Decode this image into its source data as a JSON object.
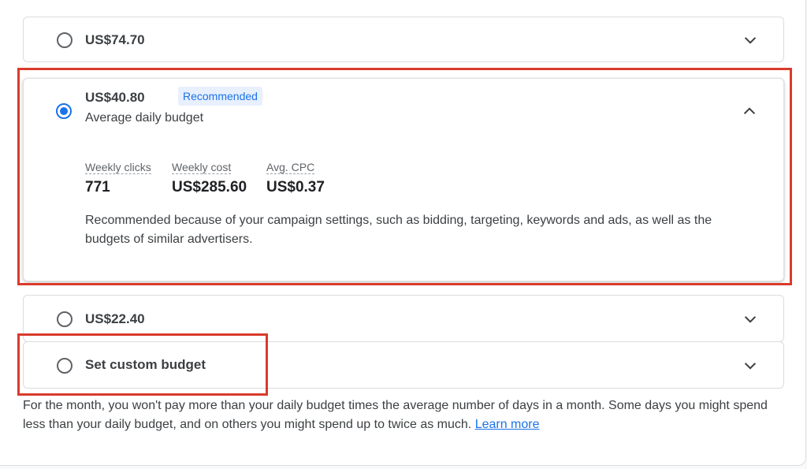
{
  "options": [
    {
      "amount": "US$74.70",
      "selected": false,
      "expanded": false
    },
    {
      "amount": "US$40.80",
      "selected": true,
      "expanded": true,
      "badge": "Recommended",
      "subtitle": "Average daily budget",
      "metrics": [
        {
          "label": "Weekly clicks",
          "value": "771"
        },
        {
          "label": "Weekly cost",
          "value": "US$285.60"
        },
        {
          "label": "Avg. CPC",
          "value": "US$0.37"
        }
      ],
      "reason": "Recommended because of your campaign settings, such as bidding, targeting, keywords and ads, as well as the budgets of similar advertisers."
    },
    {
      "amount": "US$22.40",
      "selected": false,
      "expanded": false
    },
    {
      "amount": "Set custom budget",
      "selected": false,
      "expanded": false
    }
  ],
  "footnote": {
    "text": "For the month, you won't pay more than your daily budget times the average number of days in a month. Some days you might spend less than your daily budget, and on others you might spend up to twice as much.",
    "link": "Learn more"
  },
  "icons": {
    "radio": "radio-button-icon",
    "expand": "chevron-down-icon",
    "collapse": "chevron-up-icon"
  },
  "colors": {
    "accent": "#1a73e8",
    "badge_bg": "#e8f0fe",
    "highlight": "#d93b2b"
  }
}
